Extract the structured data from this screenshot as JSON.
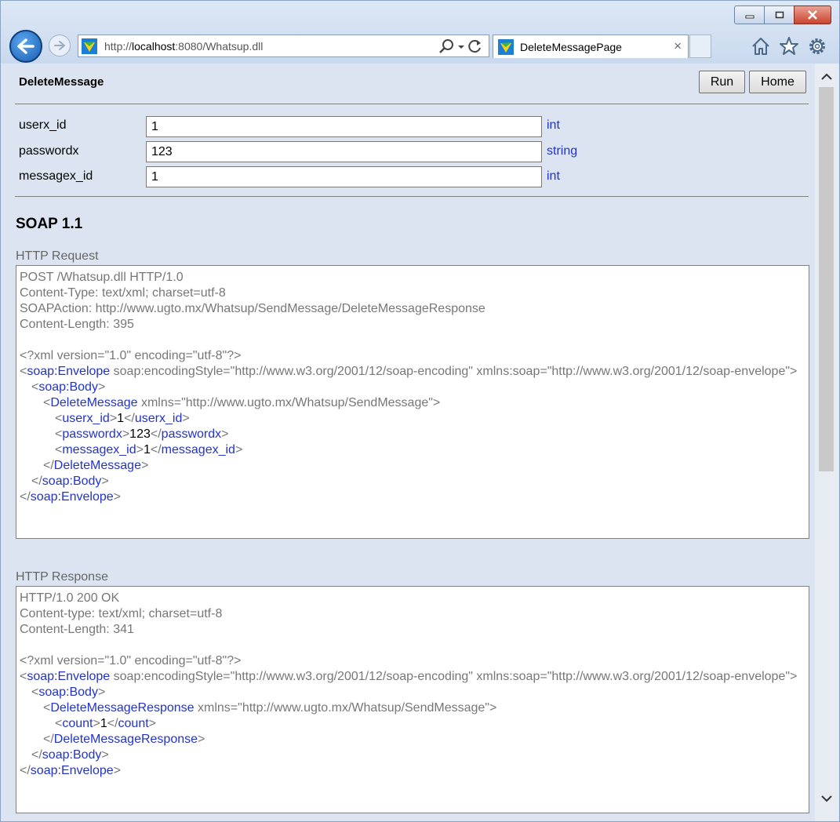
{
  "browser": {
    "url_prefix": "http://",
    "url_host": "localhost",
    "url_rest": ":8080/Whatsup.dll",
    "tab_title": "DeleteMessagePage",
    "tab_close": "×"
  },
  "page": {
    "title": "DeleteMessage",
    "run_label": "Run",
    "home_label": "Home"
  },
  "params": [
    {
      "name": "userx_id",
      "value": "1",
      "type": "int"
    },
    {
      "name": "passwordx",
      "value": "123",
      "type": "string"
    },
    {
      "name": "messagex_id",
      "value": "1",
      "type": "int"
    }
  ],
  "soap": {
    "heading": "SOAP 1.1",
    "request_label": "HTTP Request",
    "response_label": "HTTP Response",
    "request": {
      "line1": "POST /Whatsup.dll HTTP/1.0",
      "line2": "Content-Type: text/xml; charset=utf-8",
      "line3": "SOAPAction: http://www.ugto.mx/Whatsup/SendMessage/DeleteMessageResponse",
      "line4": "Content-Length: 395",
      "xmldecl": "<?xml version=\"1.0\" encoding=\"utf-8\"?>",
      "env_tag": "soap:Envelope",
      "env_attrs": " soap:encodingStyle=\"http://www.w3.org/2001/12/soap-encoding\" xmlns:soap=\"http://www.w3.org/2001/12/soap-envelope\">",
      "body_tag": "soap:Body",
      "op_tag": "DeleteMessage",
      "op_attrs": " xmlns=\"http://www.ugto.mx/Whatsup/SendMessage\">",
      "p1_tag": "userx_id",
      "p1_val": "1",
      "p2_tag": "passwordx",
      "p2_val": "123",
      "p3_tag": "messagex_id",
      "p3_val": "1"
    },
    "response": {
      "line1": "HTTP/1.0 200 OK",
      "line2": "Content-type: text/xml; charset=utf-8",
      "line3": "Content-Length: 341",
      "xmldecl": "<?xml version=\"1.0\" encoding=\"utf-8\"?>",
      "env_tag": "soap:Envelope",
      "env_attrs": " soap:encodingStyle=\"http://www.w3.org/2001/12/soap-encoding\" xmlns:soap=\"http://www.w3.org/2001/12/soap-envelope\">",
      "body_tag": "soap:Body",
      "op_tag": "DeleteMessageResponse",
      "op_attrs": " xmlns=\"http://www.ugto.mx/Whatsup/SendMessage\">",
      "c_tag": "count",
      "c_val": "1"
    }
  },
  "colors": {
    "tag": "#2233cc",
    "text": "#777777",
    "background": "#dbe4f0"
  },
  "icons": [
    "back-icon",
    "forward-icon",
    "search-icon",
    "dropdown-icon",
    "refresh-icon",
    "home-icon",
    "favorites-icon",
    "settings-icon",
    "minimize-icon",
    "maximize-icon",
    "close-icon"
  ]
}
